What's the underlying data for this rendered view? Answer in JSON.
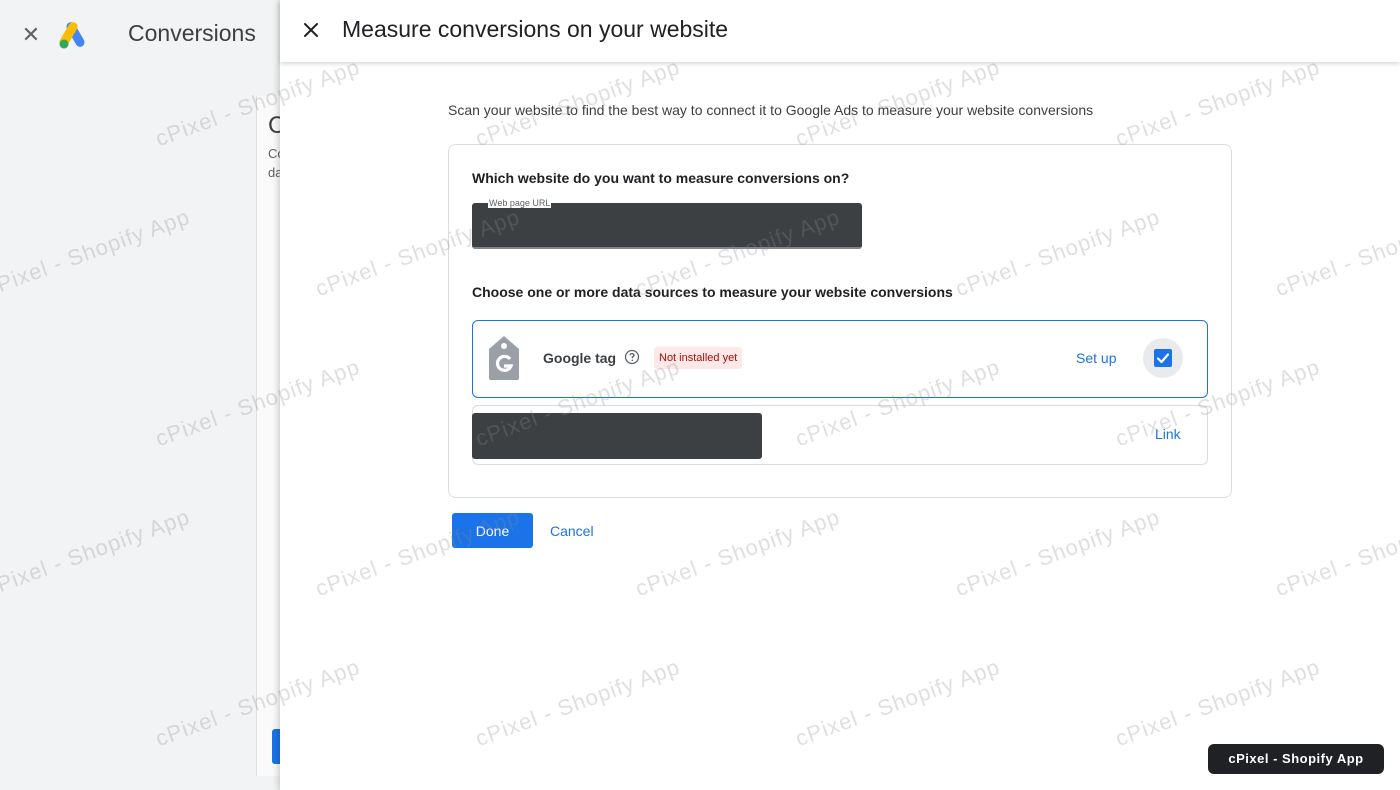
{
  "background": {
    "app_title": "Conversions",
    "heading_fragment": "C",
    "sub_fragment_1": "Co",
    "sub_fragment_2": "da"
  },
  "panel": {
    "title": "Measure conversions on your website",
    "intro": "Scan your website to find the best way to connect it to Google Ads to measure your website conversions",
    "website_question": "Which website do you want to measure conversions on?",
    "url_field": {
      "label": "Web page URL",
      "value": ""
    },
    "sources_question": "Choose one or more data sources to measure your website conversions",
    "google_tag": {
      "name": "Google tag",
      "status": "Not installed yet",
      "action": "Set up",
      "checked": true
    },
    "second_source": {
      "action": "Link"
    },
    "buttons": {
      "done": "Done",
      "cancel": "Cancel"
    }
  },
  "watermark": {
    "text": "cPixel - Shopify App"
  },
  "colors": {
    "primary": "#1a73e8",
    "badge_bg": "#fce8e6",
    "badge_text": "#a50e0e",
    "redacted": "#3c4043"
  },
  "icons": {
    "close": "close-icon",
    "logo": "google-ads-logo",
    "tag": "google-tag-icon",
    "help": "help-icon",
    "check": "checkbox-checked-icon"
  }
}
